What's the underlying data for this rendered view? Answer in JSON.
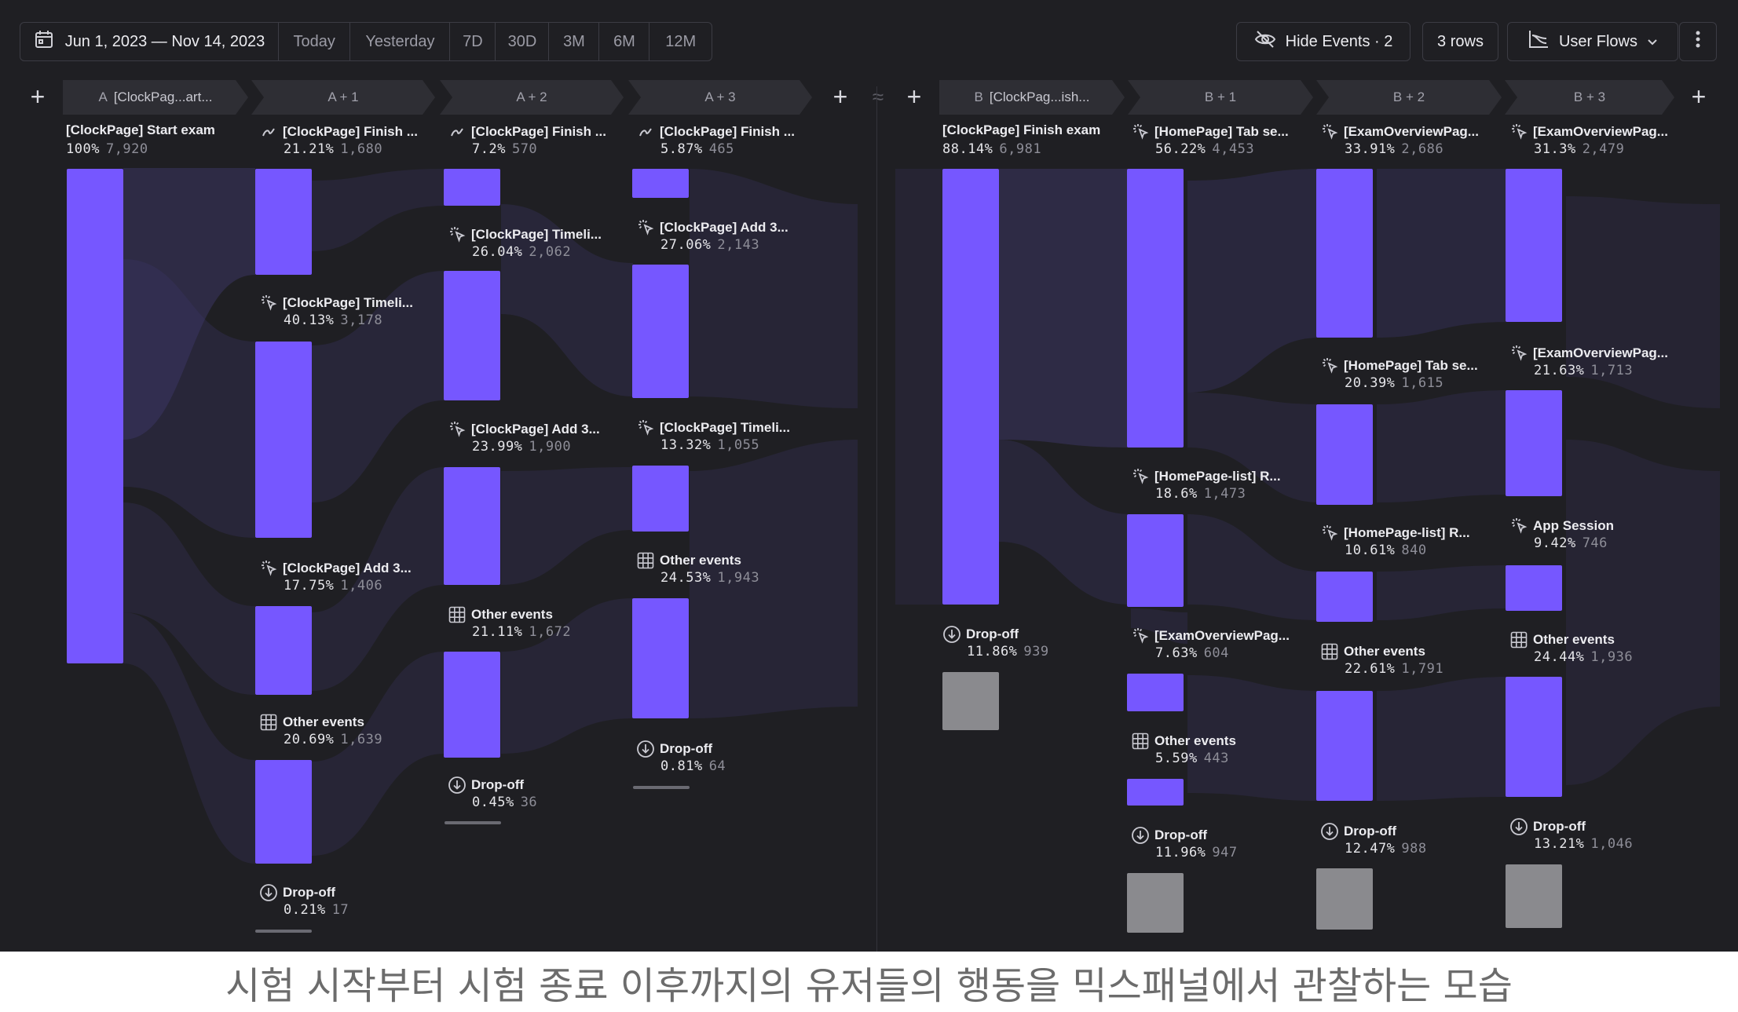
{
  "toolbar": {
    "date_range": "Jun 1, 2023 — Nov 14, 2023",
    "ranges": [
      "Today",
      "Yesterday",
      "7D",
      "30D",
      "3M",
      "6M",
      "12M"
    ],
    "hide_events": "Hide Events · 2",
    "rows": "3 rows",
    "user_flows": "User Flows"
  },
  "divider_symbol": "≈",
  "columns": [
    {
      "letter": "A",
      "name": "[ClockPag...art..."
    },
    {
      "name": "A + 1"
    },
    {
      "name": "A + 2"
    },
    {
      "name": "A + 3"
    },
    {
      "letter": "B",
      "name": "[ClockPag...ish..."
    },
    {
      "name": "B + 1"
    },
    {
      "name": "B + 2"
    },
    {
      "name": "B + 3"
    }
  ],
  "nodes": [
    {
      "col": 0,
      "label": "[ClockPage] Start exam",
      "pct": "100%",
      "count": "7,920",
      "icon": "none"
    },
    {
      "col": 1,
      "label": "[ClockPage] Finish ...",
      "pct": "21.21%",
      "count": "1,680",
      "icon": "pen-icon"
    },
    {
      "col": 1,
      "label": "[ClockPage] Timeli...",
      "pct": "40.13%",
      "count": "3,178",
      "icon": "click-icon"
    },
    {
      "col": 1,
      "label": "[ClockPage] Add 3...",
      "pct": "17.75%",
      "count": "1,406",
      "icon": "click-icon"
    },
    {
      "col": 1,
      "label": "Other events",
      "pct": "20.69%",
      "count": "1,639",
      "icon": "grid-icon"
    },
    {
      "col": 1,
      "label": "Drop-off",
      "pct": "0.21%",
      "count": "17",
      "icon": "dropoff-icon"
    },
    {
      "col": 2,
      "label": "[ClockPage] Finish ...",
      "pct": "7.2%",
      "count": "570",
      "icon": "pen-icon"
    },
    {
      "col": 2,
      "label": "[ClockPage] Timeli...",
      "pct": "26.04%",
      "count": "2,062",
      "icon": "click-icon"
    },
    {
      "col": 2,
      "label": "[ClockPage] Add 3...",
      "pct": "23.99%",
      "count": "1,900",
      "icon": "click-icon"
    },
    {
      "col": 2,
      "label": "Other events",
      "pct": "21.11%",
      "count": "1,672",
      "icon": "grid-icon"
    },
    {
      "col": 2,
      "label": "Drop-off",
      "pct": "0.45%",
      "count": "36",
      "icon": "dropoff-icon"
    },
    {
      "col": 3,
      "label": "[ClockPage] Finish ...",
      "pct": "5.87%",
      "count": "465",
      "icon": "pen-icon"
    },
    {
      "col": 3,
      "label": "[ClockPage] Add 3...",
      "pct": "27.06%",
      "count": "2,143",
      "icon": "click-icon"
    },
    {
      "col": 3,
      "label": "[ClockPage] Timeli...",
      "pct": "13.32%",
      "count": "1,055",
      "icon": "click-icon"
    },
    {
      "col": 3,
      "label": "Other events",
      "pct": "24.53%",
      "count": "1,943",
      "icon": "grid-icon"
    },
    {
      "col": 3,
      "label": "Drop-off",
      "pct": "0.81%",
      "count": "64",
      "icon": "dropoff-icon"
    },
    {
      "col": 4,
      "label": "[ClockPage] Finish exam",
      "pct": "88.14%",
      "count": "6,981",
      "icon": "none"
    },
    {
      "col": 4,
      "label": "Drop-off",
      "pct": "11.86%",
      "count": "939",
      "icon": "dropoff-icon"
    },
    {
      "col": 5,
      "label": "[HomePage] Tab se...",
      "pct": "56.22%",
      "count": "4,453",
      "icon": "click-icon"
    },
    {
      "col": 5,
      "label": "[HomePage-list] R...",
      "pct": "18.6%",
      "count": "1,473",
      "icon": "click-icon"
    },
    {
      "col": 5,
      "label": "[ExamOverviewPag...",
      "pct": "7.63%",
      "count": "604",
      "icon": "click-icon"
    },
    {
      "col": 5,
      "label": "Other events",
      "pct": "5.59%",
      "count": "443",
      "icon": "grid-icon"
    },
    {
      "col": 5,
      "label": "Drop-off",
      "pct": "11.96%",
      "count": "947",
      "icon": "dropoff-icon"
    },
    {
      "col": 6,
      "label": "[ExamOverviewPag...",
      "pct": "33.91%",
      "count": "2,686",
      "icon": "click-icon"
    },
    {
      "col": 6,
      "label": "[HomePage] Tab se...",
      "pct": "20.39%",
      "count": "1,615",
      "icon": "click-icon"
    },
    {
      "col": 6,
      "label": "[HomePage-list] R...",
      "pct": "10.61%",
      "count": "840",
      "icon": "click-icon"
    },
    {
      "col": 6,
      "label": "Other events",
      "pct": "22.61%",
      "count": "1,791",
      "icon": "grid-icon"
    },
    {
      "col": 6,
      "label": "Drop-off",
      "pct": "12.47%",
      "count": "988",
      "icon": "dropoff-icon"
    },
    {
      "col": 7,
      "label": "[ExamOverviewPag...",
      "pct": "31.3%",
      "count": "2,479",
      "icon": "click-icon"
    },
    {
      "col": 7,
      "label": "[ExamOverviewPag...",
      "pct": "21.63%",
      "count": "1,713",
      "icon": "click-icon"
    },
    {
      "col": 7,
      "label": "App Session",
      "pct": "9.42%",
      "count": "746",
      "icon": "click-icon"
    },
    {
      "col": 7,
      "label": "Other events",
      "pct": "24.44%",
      "count": "1,936",
      "icon": "grid-icon"
    },
    {
      "col": 7,
      "label": "Drop-off",
      "pct": "13.21%",
      "count": "1,046",
      "icon": "dropoff-icon"
    }
  ],
  "caption": "시험 시작부터 시험 종료 이후까지의 유저들의 행동을 믹스패널에서 관찰하는 모습",
  "colors": {
    "bar": "#7657ff",
    "dropoff_bar": "#8a8a8e",
    "flow": "#3d3668",
    "background": "#1f1f23"
  }
}
